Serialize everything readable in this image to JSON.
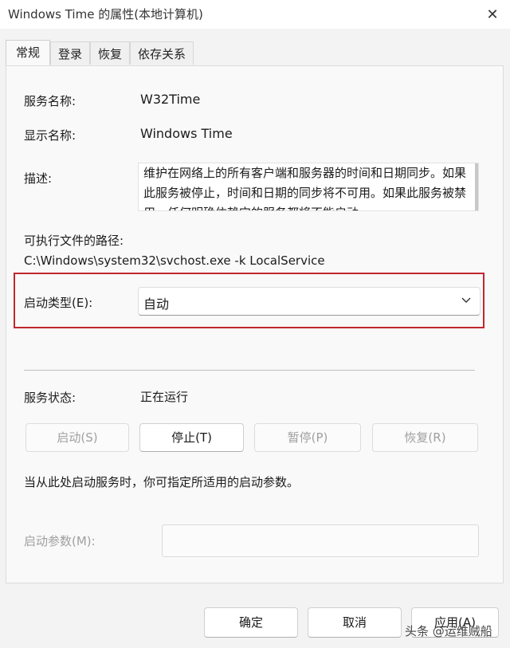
{
  "window": {
    "title": "Windows Time 的属性(本地计算机)",
    "close_glyph": "✕"
  },
  "tabs": [
    {
      "label": "常规",
      "active": true
    },
    {
      "label": "登录",
      "active": false
    },
    {
      "label": "恢复",
      "active": false
    },
    {
      "label": "依存关系",
      "active": false
    }
  ],
  "general": {
    "service_name_label": "服务名称:",
    "service_name_value": "W32Time",
    "display_name_label": "显示名称:",
    "display_name_value": "Windows Time",
    "description_label": "描述:",
    "description_value": "维护在网络上的所有客户端和服务器的时间和日期同步。如果此服务被停止，时间和日期的同步将不可用。如果此服务被禁用，任何明确依赖它的服务都将不能启动。",
    "path_label": "可执行文件的路径:",
    "path_value": "C:\\Windows\\system32\\svchost.exe -k LocalService",
    "startup_type_label": "启动类型(E):",
    "startup_type_value": "自动",
    "service_status_label": "服务状态:",
    "service_status_value": "正在运行",
    "hint_text": "当从此处启动服务时，你可指定所适用的启动参数。",
    "start_params_label": "启动参数(M):",
    "start_params_value": ""
  },
  "service_buttons": {
    "start": "启动(S)",
    "stop": "停止(T)",
    "pause": "暂停(P)",
    "resume": "恢复(R)"
  },
  "dialog_buttons": {
    "ok": "确定",
    "cancel": "取消",
    "apply": "应用(A)"
  },
  "watermark": "头条 @运维贼船",
  "colors": {
    "highlight_border": "#c0272d",
    "disabled_text": "#a0a0a0"
  }
}
